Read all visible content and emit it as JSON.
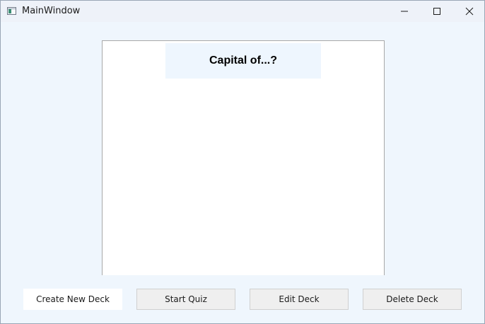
{
  "window": {
    "title": "MainWindow",
    "icons": [
      "app-icon",
      "minimize-icon",
      "maximize-icon",
      "close-icon"
    ]
  },
  "card": {
    "question": "Capital of...?"
  },
  "actions": {
    "create_label": "Create New Deck",
    "start_label": "Start Quiz",
    "edit_label": "Edit Deck",
    "delete_label": "Delete Deck"
  },
  "colors": {
    "window_background": "#eff6fd",
    "titlebar_background": "#eef2f9",
    "question_background": "#eef6fe",
    "button_background": "#efefef"
  }
}
